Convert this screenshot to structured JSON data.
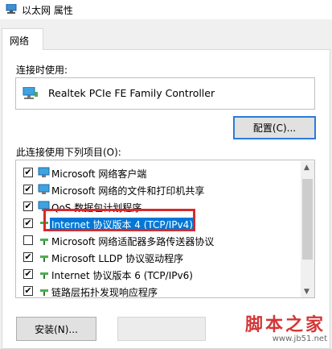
{
  "window": {
    "title": "以太网 属性"
  },
  "tabs": [
    {
      "label": "网络"
    }
  ],
  "connect_label": "连接时使用:",
  "adapter": {
    "name": "Realtek PCIe FE Family Controller"
  },
  "configure_button": "配置(C)...",
  "items_label": "此连接使用下列项目(O):",
  "items": [
    {
      "label": "Microsoft 网络客户端",
      "checked": true
    },
    {
      "label": "Microsoft 网络的文件和打印机共享",
      "checked": true
    },
    {
      "label": "QoS 数据包计划程序",
      "checked": true
    },
    {
      "label": "Internet 协议版本 4 (TCP/IPv4)",
      "checked": true,
      "selected": true
    },
    {
      "label": "Microsoft 网络适配器多路传送器协议",
      "checked": false
    },
    {
      "label": "Microsoft LLDP 协议驱动程序",
      "checked": true
    },
    {
      "label": "Internet 协议版本 6 (TCP/IPv6)",
      "checked": true
    },
    {
      "label": "链路层拓扑发现响应程序",
      "checked": true
    }
  ],
  "install_button": "安装(N)...",
  "uninstall_button": "",
  "watermark": {
    "text": "脚本之家",
    "url": "www.jb51.net"
  },
  "colors": {
    "selection": "#0078d7",
    "highlight_border": "#d62b2b",
    "focus_border": "#2b7bd9"
  }
}
